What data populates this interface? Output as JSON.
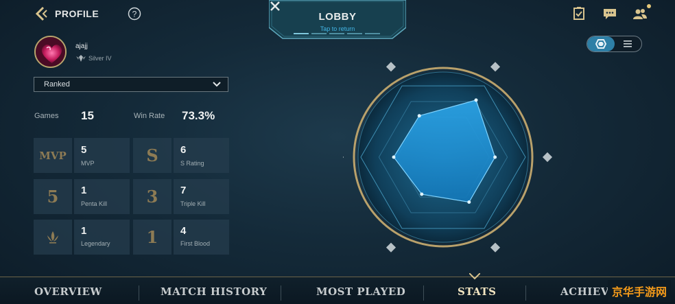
{
  "header": {
    "title": "PROFILE"
  },
  "lobby": {
    "title": "LOBBY",
    "subtitle": "Tap to return"
  },
  "player": {
    "name": "ajajj",
    "rank": "Silver IV"
  },
  "mode_dropdown": {
    "value": "Ranked"
  },
  "summary": {
    "games_label": "Games",
    "games_value": "15",
    "winrate_label": "Win Rate",
    "winrate_value": "73.3%"
  },
  "stats": [
    {
      "icon": "MVP",
      "value": "5",
      "label": "MVP"
    },
    {
      "icon": "S",
      "value": "6",
      "label": "S Rating"
    },
    {
      "icon": "5",
      "value": "1",
      "label": "Penta Kill"
    },
    {
      "icon": "3",
      "value": "7",
      "label": "Triple Kill"
    },
    {
      "icon": "legendary-icon",
      "value": "1",
      "label": "Legendary"
    },
    {
      "icon": "1",
      "value": "4",
      "label": "First Blood"
    }
  ],
  "radar": {
    "axes": [
      "assassin-icon",
      "fighter-icon",
      "mage-icon",
      "marksman-icon",
      "tank-icon",
      "support-icon"
    ],
    "levels": [
      0.58,
      0.8,
      0.63,
      0.63,
      0.52,
      0.6
    ]
  },
  "tabs": [
    {
      "label": "OVERVIEW",
      "active": false
    },
    {
      "label": "MATCH HISTORY",
      "active": false
    },
    {
      "label": "MOST PLAYED",
      "active": false
    },
    {
      "label": "STATS",
      "active": true
    },
    {
      "label": "ACHIEV",
      "active": false
    }
  ],
  "watermark": {
    "text": "京华手游网"
  },
  "colors": {
    "accent_gold": "#c9b47c",
    "radar_fill": "#1d8ed3",
    "bg": "#142a39"
  }
}
